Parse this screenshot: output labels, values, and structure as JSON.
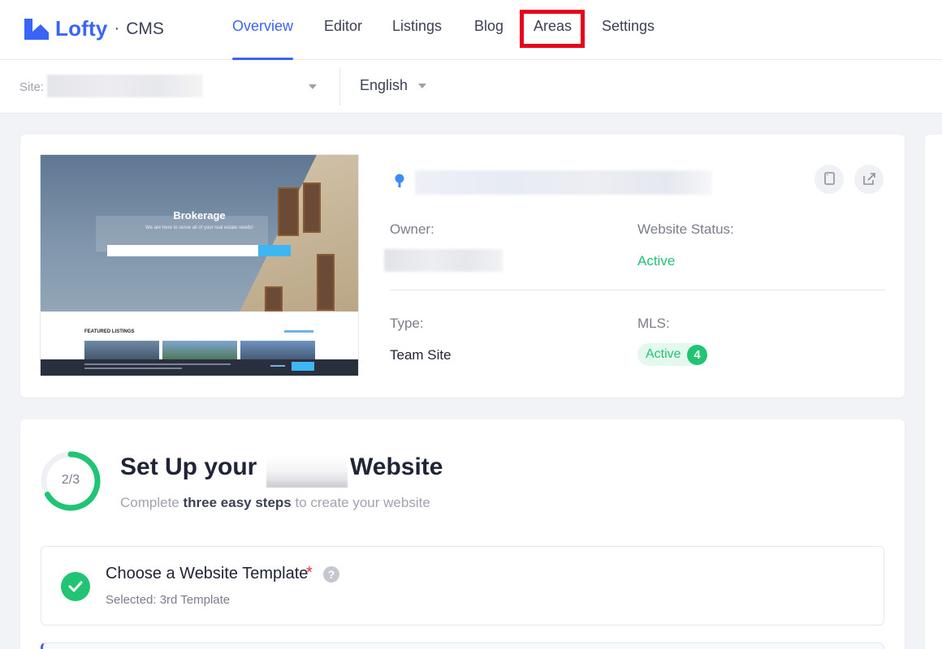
{
  "brand": {
    "name": "Lofty",
    "separator": "·",
    "product": "CMS"
  },
  "nav": {
    "tabs": [
      {
        "label": "Overview",
        "active": true
      },
      {
        "label": "Editor"
      },
      {
        "label": "Listings"
      },
      {
        "label": "Blog"
      },
      {
        "label": "Areas",
        "highlighted": true
      },
      {
        "label": "Settings"
      }
    ]
  },
  "subbar": {
    "site_label": "Site:",
    "language": "English"
  },
  "preview": {
    "brand": "Brokerage",
    "tagline": "We are here to serve all of your real estate needs!",
    "featured": "FEATURED LISTINGS"
  },
  "site_info": {
    "owner_label": "Owner:",
    "status_label": "Website Status:",
    "status_value": "Active",
    "type_label": "Type:",
    "type_value": "Team Site",
    "mls_label": "MLS:",
    "mls_status": "Active",
    "mls_count": "4"
  },
  "setup": {
    "progress": "2/3",
    "progress_fraction": 0.6667,
    "title_prefix": "Set Up your",
    "title_suffix": "Website",
    "subtitle_pre": "Complete",
    "subtitle_bold": "three easy steps",
    "subtitle_post": "to create your website",
    "steps": [
      {
        "title": "Choose a Website Template",
        "required": "*",
        "help": "?",
        "selected": "Selected: 3rd Template",
        "done": true
      }
    ]
  },
  "colors": {
    "accent": "#3b64f6",
    "success": "#20c472",
    "highlight": "#e6001a"
  }
}
